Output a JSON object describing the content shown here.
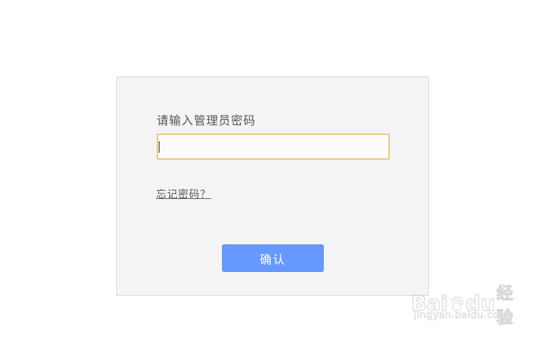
{
  "login": {
    "prompt_label": "请输入管理员密码",
    "password_value": "",
    "password_placeholder": "",
    "forgot_link": "忘记密码？",
    "confirm_button": "确认"
  },
  "watermark": {
    "brand_left": "Bai",
    "brand_right": "du",
    "brand_suffix": "经验",
    "url": "jingyan.baidu.com"
  },
  "colors": {
    "panel_bg": "#f4f4f4",
    "input_border": "#e8c47c",
    "button_bg": "#6699ff",
    "button_text": "#ffffff",
    "label_text": "#555555"
  },
  "icons": {
    "watermark_logo": "baidu-paw-icon"
  }
}
